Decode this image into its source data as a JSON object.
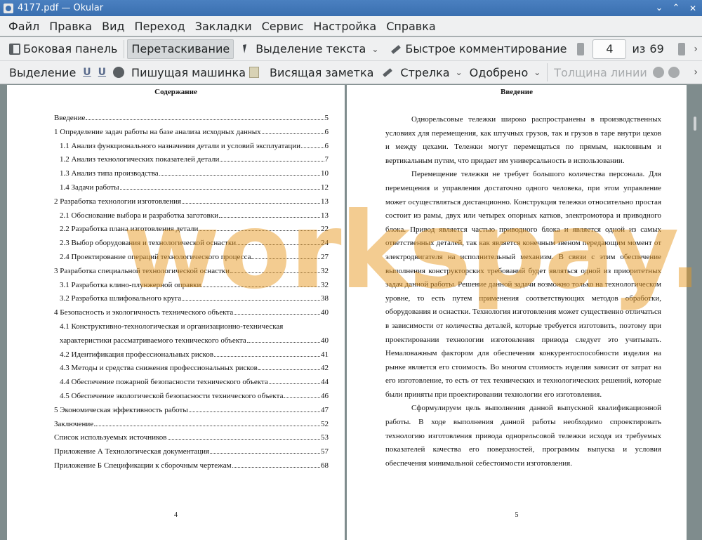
{
  "window": {
    "title": "4177.pdf  — Okular",
    "controls": {
      "minimize": "⌄",
      "maximize": "⌃",
      "close": "✕"
    }
  },
  "menu": [
    "Файл",
    "Правка",
    "Вид",
    "Переход",
    "Закладки",
    "Сервис",
    "Настройка",
    "Справка"
  ],
  "toolbar1": {
    "sidebar": "Боковая панель",
    "drag": "Перетаскивание",
    "text_select": "Выделение текста",
    "quick_annotate": "Быстрое комментирование",
    "page_current": "4",
    "page_of": "из",
    "page_total": "69",
    "more": "›"
  },
  "toolbar2": {
    "selection": "Выделение",
    "underline1": "U",
    "underline2": "U",
    "typewriter": "Пишущая машинка",
    "popup_note": "Висящая заметка",
    "arrow": "Стрелка",
    "stamp": "Одобрено",
    "line_width": "Толщина линии",
    "more": "›"
  },
  "left_page": {
    "heading": "Содержание",
    "toc": [
      {
        "title": "Введение",
        "page": "5",
        "sub": false
      },
      {
        "title": "1 Определение задач работы на базе анализа исходных данных",
        "page": "6",
        "sub": false
      },
      {
        "title": "1.1 Анализ функционального назначения детали и условий эксплуатации",
        "page": "6",
        "sub": true
      },
      {
        "title": "1.2 Анализ технологических показателей детали",
        "page": "7",
        "sub": true
      },
      {
        "title": "1.3 Анализ типа производства",
        "page": "10",
        "sub": true
      },
      {
        "title": "1.4 Задачи работы",
        "page": "12",
        "sub": true
      },
      {
        "title": "2 Разработка технологии изготовления",
        "page": "13",
        "sub": false
      },
      {
        "title": "2.1 Обоснование выбора и разработка заготовки",
        "page": "13",
        "sub": true
      },
      {
        "title": "2.2 Разработка плана изготовления детали",
        "page": "22",
        "sub": true
      },
      {
        "title": "2.3 Выбор оборудования и технологической оснастки",
        "page": "24",
        "sub": true
      },
      {
        "title": "2.4 Проектирование операций технологического процесса",
        "page": "27",
        "sub": true
      },
      {
        "title": "3 Разработка специальной технологической оснастки",
        "page": "32",
        "sub": false
      },
      {
        "title": "3.1 Разработка клино-плунжерной оправки",
        "page": "32",
        "sub": true
      },
      {
        "title": "3.2 Разработка шлифовального круга",
        "page": "38",
        "sub": true
      },
      {
        "title": "4 Безопасность и экологичность технического объекта",
        "page": "40",
        "sub": false
      }
    ],
    "toc_multi_first": "4.1 Конструктивно-технологическая и организационно-техническая",
    "toc_multi_second": {
      "title": "характеристики рассматриваемого технического объекта",
      "page": "40"
    },
    "toc_rest": [
      {
        "title": "4.2 Идентификация профессиональных рисков",
        "page": "41",
        "sub": true
      },
      {
        "title": "4.3 Методы и средства снижения профессиональных рисков",
        "page": "42",
        "sub": true
      },
      {
        "title": "4.4 Обеспечение пожарной безопасности технического объекта",
        "page": "44",
        "sub": true
      },
      {
        "title": "4.5 Обеспечение экологической безопасности технического объекта",
        "page": "46",
        "sub": true
      },
      {
        "title": "5 Экономическая эффективность работы",
        "page": "47",
        "sub": false
      },
      {
        "title": "Заключение",
        "page": "52",
        "sub": false
      },
      {
        "title": "Список используемых источников",
        "page": "53",
        "sub": false
      },
      {
        "title": "Приложение А Технологическая документация",
        "page": "57",
        "sub": false
      },
      {
        "title": "Приложение Б Спецификации к сборочным чертежам",
        "page": "68",
        "sub": false
      }
    ],
    "page_number": "4"
  },
  "right_page": {
    "heading": "Введение",
    "paragraphs": [
      "Однорельсовые тележки широко распространены в производственных условиях для перемещения, как штучных грузов, так и грузов в таре внутри цехов и между цехами. Тележки могут перемещаться по прямым, наклонным и вертикальным путям, что придает им универсальность в использовании.",
      "Перемещение тележки не требует большого количества персонала. Для перемещения и управления достаточно одного человека, при этом управление может осуществляться дистанционно. Конструкция тележки относительно простая состоит из рамы, двух или четырех опорных катков, электромотора и приводного блока. Привод является частью приводного блока и является одной из самых ответственных деталей, так как является конечным звеном передающим момент от электродвигателя на исполнительный механизм. В связи с этим обеспечение выполнения конструкторских требований будет являться одной из приоритетных задач данной работы. Решение данной задачи возможно только на технологическом уровне, то есть путем применения соответствующих методов обработки, оборудования и оснастки. Технология изготовления может существенно отличаться в зависимости от количества деталей, которые требуется изготовить, поэтому при проектировании технологии изготовления привода следует это учитывать. Немаловажным фактором для обеспечения конкурентоспособности изделия на рынке является его стоимость. Во многом стоимость изделия зависит от затрат на его изготовление, то есть от тех технических и технологических решений, которые были приняты при проектировании технологии его изготовления.",
      "Сформулируем цель выполнения данной выпускной квалификационной работы. В ходе выполнения данной работы необходимо спроектировать технологию изготовления привода однорельсовой тележки исходя из требуемых показателей качества его поверхностей, программы выпуска и условия обеспечения минимальной себестоимости изготовления."
    ],
    "page_number": "5"
  },
  "watermark": "workspay.ru",
  "colors": {
    "titlebar": "#3a6fb0",
    "toolbar": "#eff0f1",
    "doc_bg": "#7f8c8d",
    "watermark": "#e89a24"
  }
}
